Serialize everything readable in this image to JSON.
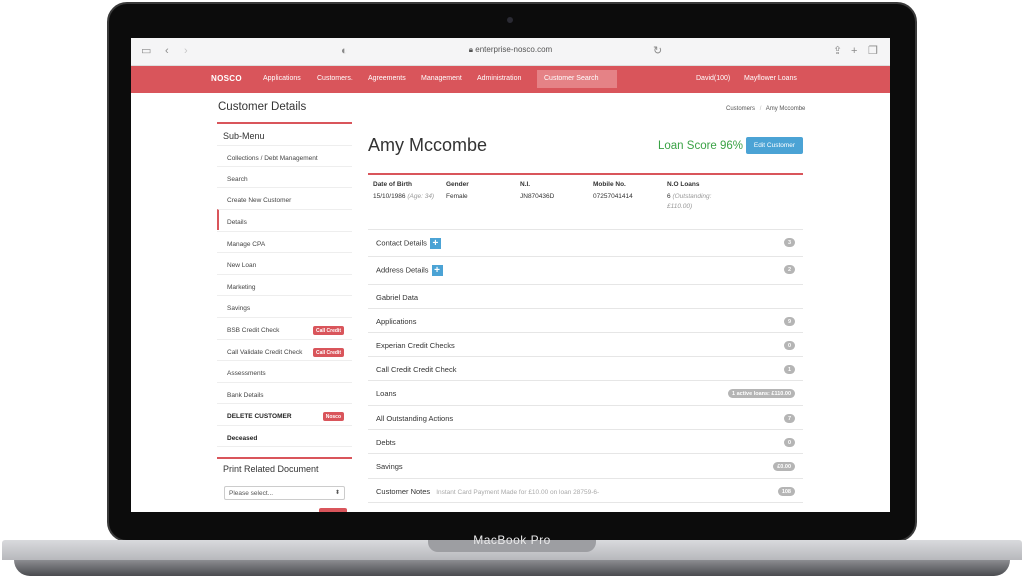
{
  "device": {
    "brand": "MacBook Pro"
  },
  "browser": {
    "url": "enterprise-nosco.com"
  },
  "nav": {
    "logo": "NOSCO",
    "items": [
      "Applications",
      "Customers.",
      "Agreements",
      "Management",
      "Administration"
    ],
    "search": "Customer Search",
    "user": "David(100)",
    "company": "Mayflower Loans"
  },
  "sidebar": {
    "title": "Customer Details",
    "submenu_title": "Sub-Menu",
    "items": [
      {
        "label": "Collections / Debt Management"
      },
      {
        "label": "Search"
      },
      {
        "label": "Create New Customer"
      },
      {
        "label": "Details"
      },
      {
        "label": "Manage CPA"
      },
      {
        "label": "New Loan"
      },
      {
        "label": "Marketing"
      },
      {
        "label": "Savings"
      },
      {
        "label": "BSB Credit Check",
        "tag": "Call Credit"
      },
      {
        "label": "Call Validate Credit Check",
        "tag": "Call Credit"
      },
      {
        "label": "Assessments"
      },
      {
        "label": "Bank Details"
      },
      {
        "label": "DELETE CUSTOMER",
        "tag": "Nosco"
      },
      {
        "label": "Deceased"
      }
    ],
    "print_title": "Print Related Document",
    "select_placeholder": "Please select..."
  },
  "breadcrumb": {
    "root": "Customers",
    "sep": "/",
    "current": "Amy Mccombe"
  },
  "customer": {
    "name": "Amy Mccombe",
    "loan_score": "Loan Score 96%",
    "edit_label": "Edit Customer",
    "info": {
      "dob_label": "Date of Birth",
      "dob": "15/10/1986",
      "dob_extra": "(Age: 34)",
      "gender_label": "Gender",
      "gender": "Female",
      "ni_label": "N.I.",
      "ni": "JN870436D",
      "mobile_label": "Mobile No.",
      "mobile": "07257041414",
      "loans_label": "N.O Loans",
      "loans": "6",
      "loans_extra": "(Outstanding: £110.00)"
    }
  },
  "sections": [
    {
      "label": "Contact Details",
      "badge": "3"
    },
    {
      "label": "Address Details",
      "badge": "2"
    },
    {
      "label": "Gabriel Data",
      "badge": ""
    },
    {
      "label": "Applications",
      "badge": "9"
    },
    {
      "label": "Experian Credit Checks",
      "badge": "0"
    },
    {
      "label": "Call Credit Credit Check",
      "badge": "1"
    },
    {
      "label": "Loans",
      "badge": "1 active loans: £110.00"
    },
    {
      "label": "All Outstanding Actions",
      "badge": "7"
    },
    {
      "label": "Debts",
      "badge": "0"
    },
    {
      "label": "Savings",
      "badge": "£0.00"
    },
    {
      "label": "Customer Notes",
      "note": "Instant Card Payment Made for £10.00 on loan 28759-6-",
      "badge": "108"
    }
  ],
  "colors": {
    "brand": "#d9555b",
    "accent": "#4ba3d5",
    "score": "#3aa245"
  }
}
